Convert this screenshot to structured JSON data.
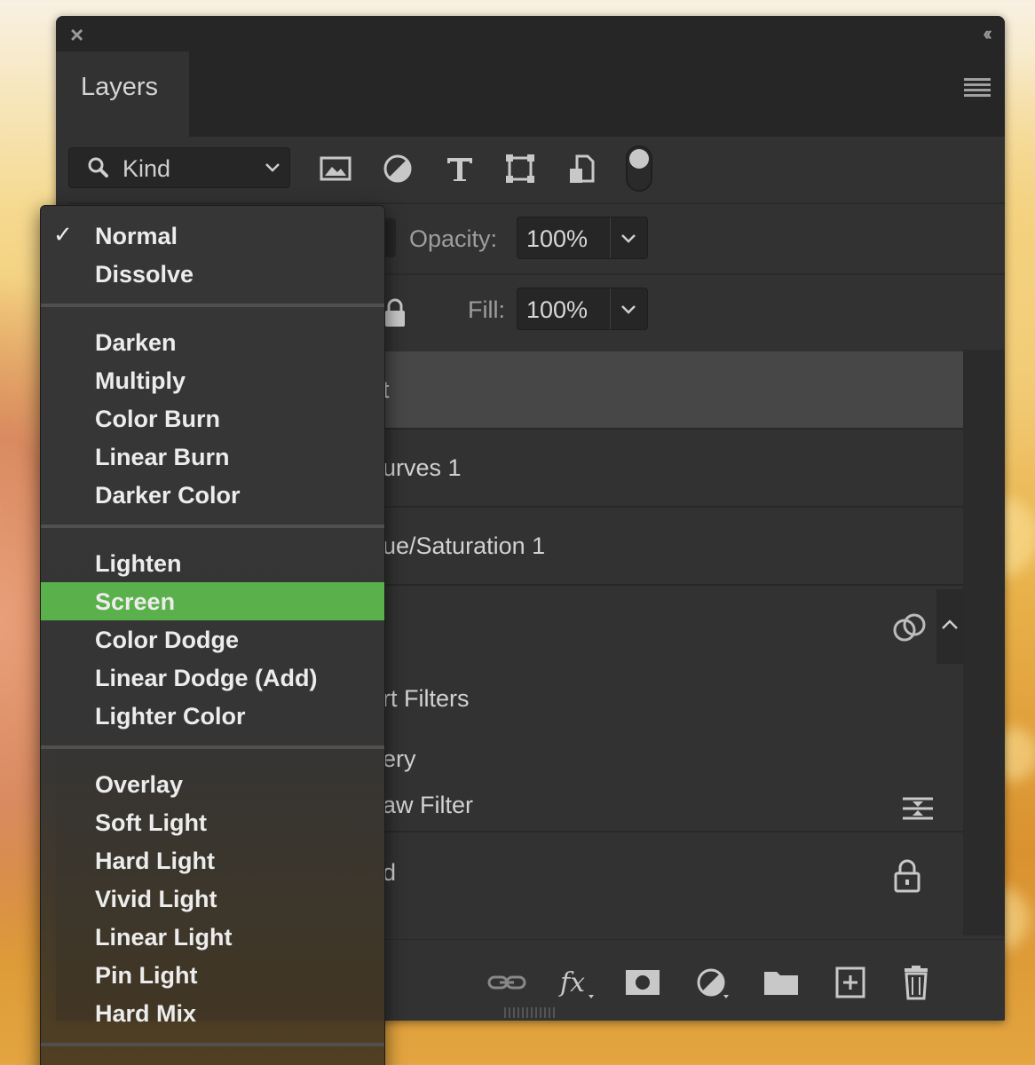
{
  "panel": {
    "tab_label": "Layers"
  },
  "filter": {
    "kind_label": "Kind",
    "icons": [
      "image-filter-icon",
      "adjustment-filter-icon",
      "type-filter-icon",
      "shape-filter-icon",
      "smart-object-filter-icon"
    ]
  },
  "controls": {
    "opacity_label": "Opacity:",
    "opacity_value": "100%",
    "fill_label": "Fill:",
    "fill_value": "100%"
  },
  "layers": {
    "row1": "t",
    "row2": "urves 1",
    "row3": "ue/Saturation 1",
    "row4_filters": "rt Filters",
    "row4_sub": "ery",
    "row4_filter": "aw Filter",
    "row5": "d"
  },
  "blend_menu": {
    "selected": "Screen",
    "checked": "Normal",
    "check_mark": "✓",
    "groups": [
      [
        "Normal",
        "Dissolve"
      ],
      [
        "Darken",
        "Multiply",
        "Color Burn",
        "Linear Burn",
        "Darker Color"
      ],
      [
        "Lighten",
        "Screen",
        "Color Dodge",
        "Linear Dodge (Add)",
        "Lighter Color"
      ],
      [
        "Overlay",
        "Soft Light",
        "Hard Light",
        "Vivid Light",
        "Linear Light",
        "Pin Light",
        "Hard Mix"
      ]
    ]
  },
  "colors": {
    "panel_bg": "#323232",
    "highlight": "#5ab04a"
  }
}
